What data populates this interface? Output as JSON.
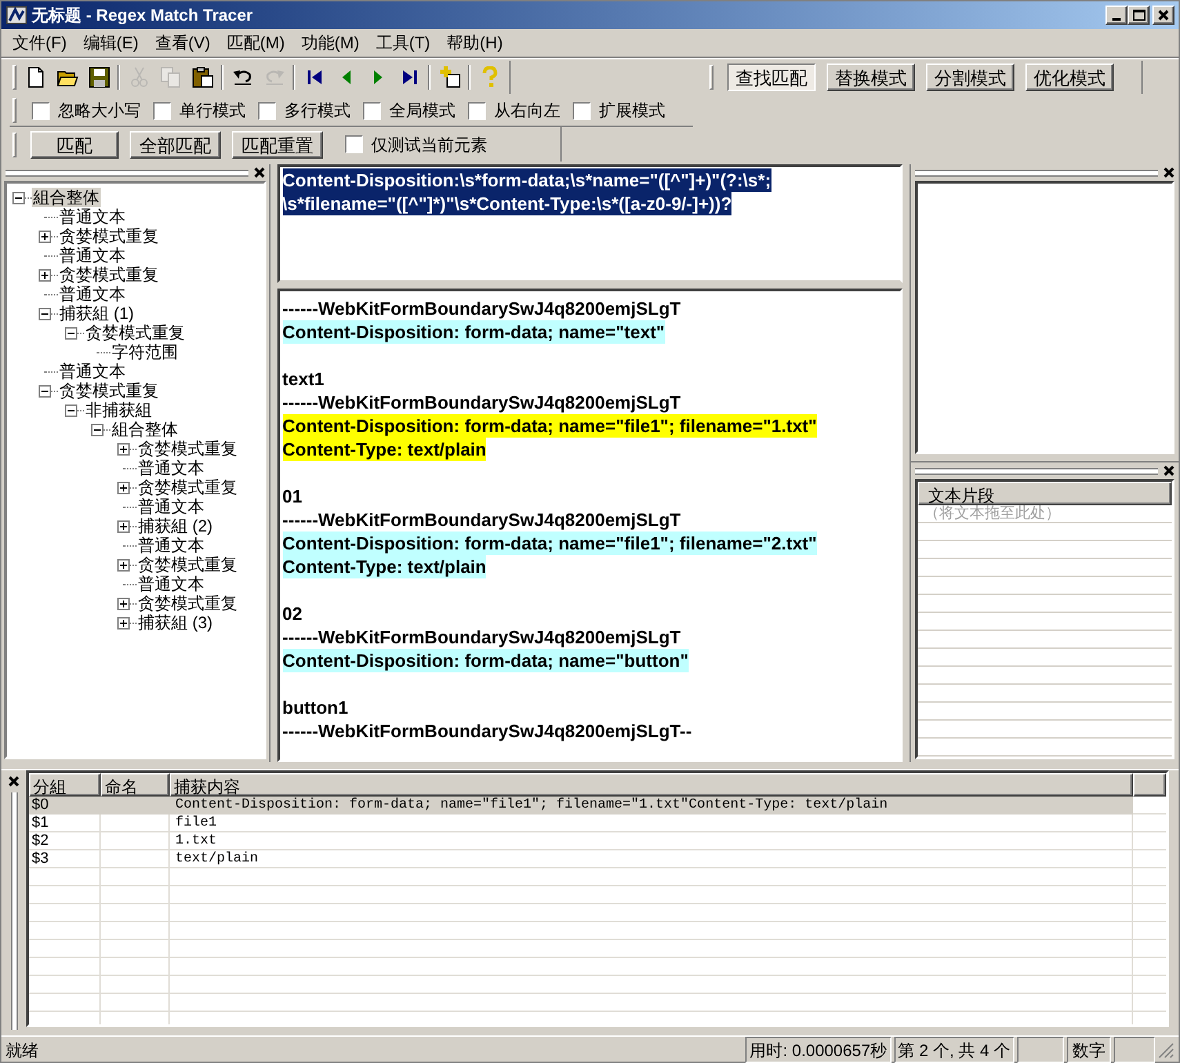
{
  "window": {
    "title": "无标题 - Regex Match Tracer"
  },
  "menu": [
    "文件(F)",
    "编辑(E)",
    "查看(V)",
    "匹配(M)",
    "功能(M)",
    "工具(T)",
    "帮助(H)"
  ],
  "toolbar": [
    {
      "kind": "new",
      "disabled": false
    },
    {
      "kind": "open",
      "disabled": false
    },
    {
      "kind": "save",
      "disabled": false
    },
    {
      "kind": "separator"
    },
    {
      "kind": "cut",
      "disabled": true
    },
    {
      "kind": "copy",
      "disabled": true
    },
    {
      "kind": "paste",
      "disabled": false
    },
    {
      "kind": "separator"
    },
    {
      "kind": "undo",
      "disabled": false
    },
    {
      "kind": "redo",
      "disabled": true
    },
    {
      "kind": "separator"
    },
    {
      "kind": "first",
      "disabled": false
    },
    {
      "kind": "prev",
      "disabled": false
    },
    {
      "kind": "next",
      "disabled": false
    },
    {
      "kind": "last",
      "disabled": false
    },
    {
      "kind": "separator"
    },
    {
      "kind": "add",
      "disabled": false
    },
    {
      "kind": "separator"
    },
    {
      "kind": "help",
      "disabled": false
    }
  ],
  "modes": [
    {
      "label": "查找匹配",
      "selected": true
    },
    {
      "label": "替换模式",
      "selected": false
    },
    {
      "label": "分割模式",
      "selected": false
    },
    {
      "label": "优化模式",
      "selected": false
    }
  ],
  "options": [
    {
      "label": "忽略大小写",
      "checked": false
    },
    {
      "label": "单行模式",
      "checked": false
    },
    {
      "label": "多行模式",
      "checked": false
    },
    {
      "label": "全局模式",
      "checked": false
    },
    {
      "label": "从右向左",
      "checked": false
    },
    {
      "label": "扩展模式",
      "checked": false
    }
  ],
  "actions": [
    "匹配",
    "全部匹配",
    "匹配重置"
  ],
  "test_current_only": {
    "label": "仅测试当前元素",
    "checked": false
  },
  "tree": {
    "label": "組合整体",
    "expanded": true,
    "selected": true,
    "children": [
      {
        "label": "普通文本",
        "selected": false
      },
      {
        "label": "贪婪模式重复",
        "expanded": false,
        "selected": false
      },
      {
        "label": "普通文本",
        "selected": false
      },
      {
        "label": "贪婪模式重复",
        "expanded": false,
        "selected": false
      },
      {
        "label": "普通文本",
        "selected": false
      },
      {
        "label": "捕获組 (1)",
        "expanded": true,
        "selected": false,
        "children": [
          {
            "label": "贪婪模式重复",
            "expanded": true,
            "selected": false,
            "children": [
              {
                "label": "字符范围",
                "selected": false
              }
            ]
          }
        ]
      },
      {
        "label": "普通文本",
        "selected": false
      },
      {
        "label": "贪婪模式重复",
        "expanded": true,
        "selected": false,
        "children": [
          {
            "label": "非捕获組",
            "expanded": true,
            "selected": false,
            "children": [
              {
                "label": "組合整体",
                "expanded": true,
                "selected": false,
                "children": [
                  {
                    "label": "贪婪模式重复",
                    "expanded": false,
                    "selected": false
                  },
                  {
                    "label": "普通文本",
                    "selected": false
                  },
                  {
                    "label": "贪婪模式重复",
                    "expanded": false,
                    "selected": false
                  },
                  {
                    "label": "普通文本",
                    "selected": false
                  },
                  {
                    "label": "捕获組 (2)",
                    "expanded": false,
                    "selected": false
                  },
                  {
                    "label": "普通文本",
                    "selected": false
                  },
                  {
                    "label": "贪婪模式重复",
                    "expanded": false,
                    "selected": false
                  },
                  {
                    "label": "普通文本",
                    "selected": false
                  },
                  {
                    "label": "贪婪模式重复",
                    "expanded": false,
                    "selected": false
                  },
                  {
                    "label": "捕获組 (3)",
                    "expanded": false,
                    "selected": false
                  }
                ]
              }
            ]
          }
        ]
      }
    ]
  },
  "regex": {
    "lines": [
      "Content-Disposition:\\s*form-data;\\s*name=\"([^\"]+)\"(?:\\s*;",
      "\\s*filename=\"([^\"]*)\"\\s*Content-Type:\\s*([a-z0-9/-]+))?"
    ],
    "selected": true
  },
  "test_text": [
    [
      {
        "text": "------WebKitFormBoundarySwJ4q8200emjSLgT",
        "matched": false,
        "current": false
      },
      {
        "text": "Content-Disposition: form-data; name=\"text\"",
        "matched": true,
        "current": false
      }
    ],
    [
      {
        "text": "text1",
        "matched": false,
        "current": false
      },
      {
        "text": "------WebKitFormBoundarySwJ4q8200emjSLgT",
        "matched": false,
        "current": false
      },
      {
        "text": "Content-Disposition: form-data; name=\"file1\"; filename=\"1.txt\"",
        "matched": true,
        "current": true
      },
      {
        "text": "Content-Type: text/plain",
        "matched": true,
        "current": true
      }
    ],
    [
      {
        "text": "01",
        "matched": false,
        "current": false
      },
      {
        "text": "------WebKitFormBoundarySwJ4q8200emjSLgT",
        "matched": false,
        "current": false
      },
      {
        "text": "Content-Disposition: form-data; name=\"file1\"; filename=\"2.txt\"",
        "matched": true,
        "current": false
      },
      {
        "text": "Content-Type: text/plain",
        "matched": true,
        "current": false
      }
    ],
    [
      {
        "text": "02",
        "matched": false,
        "current": false
      },
      {
        "text": "------WebKitFormBoundarySwJ4q8200emjSLgT",
        "matched": false,
        "current": false
      },
      {
        "text": "Content-Disposition: form-data; name=\"button\"",
        "matched": true,
        "current": false
      }
    ],
    [
      {
        "text": "button1",
        "matched": false,
        "current": false
      },
      {
        "text": "------WebKitFormBoundarySwJ4q8200emjSLgT--",
        "matched": false,
        "current": false
      }
    ]
  ],
  "snippets": {
    "column": "文本片段",
    "placeholder": "（将文本拖至此处）"
  },
  "results": {
    "columns": [
      "分組",
      "命名",
      "捕获内容"
    ],
    "rows": [
      {
        "group": "$0",
        "content": "Content-Disposition: form-data; name=\"file1\"; filename=\"1.txt\"Content-Type: text/plain",
        "selected": true
      },
      {
        "group": "$1",
        "content": "file1",
        "selected": false
      },
      {
        "group": "$2",
        "content": "1.txt",
        "selected": false
      },
      {
        "group": "$3",
        "content": "text/plain",
        "selected": false
      }
    ]
  },
  "status_bar": {
    "message": "就绪",
    "time": "用时: 0.0000657秒",
    "position": "第 2 个, 共 4 个",
    "num_lock": "数字"
  }
}
